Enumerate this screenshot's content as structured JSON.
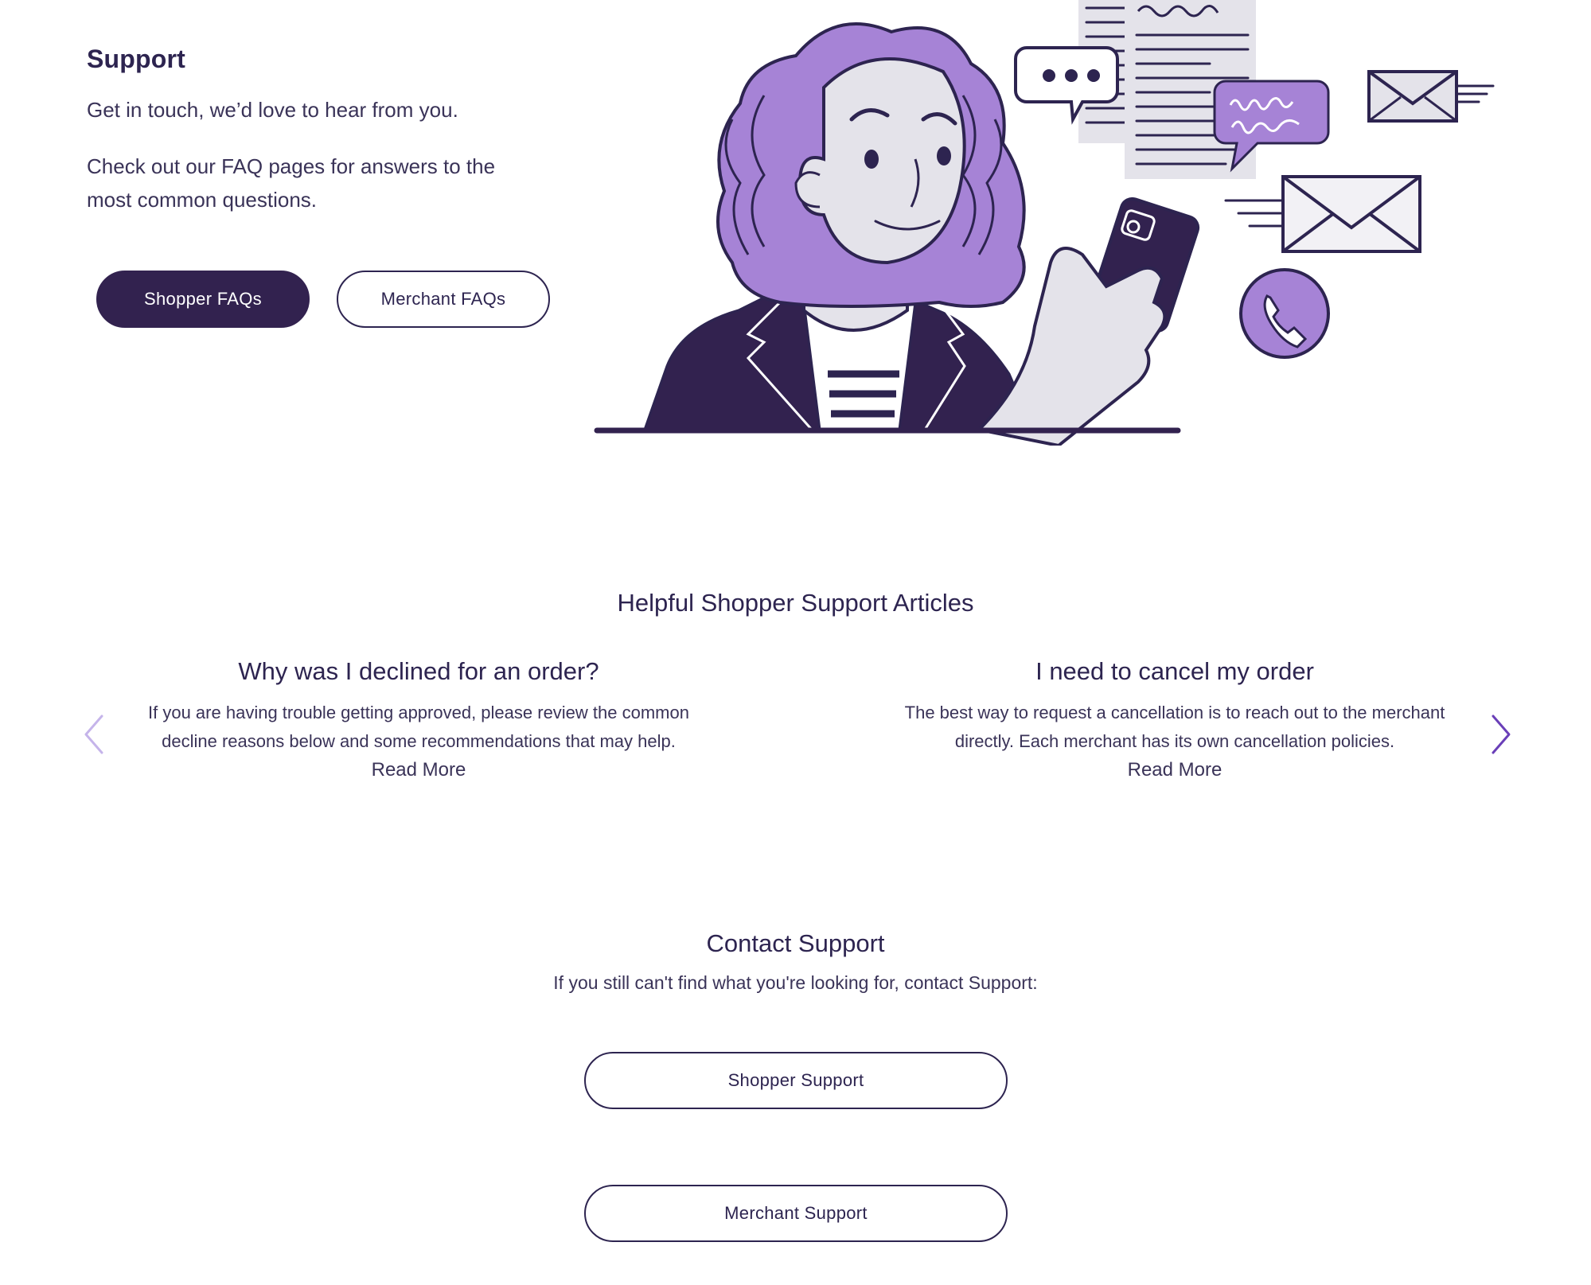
{
  "hero": {
    "title": "Support",
    "intro": "Get in touch, we’d love to hear from you.",
    "faq_text": "Check out our FAQ pages for answers to the most common questions.",
    "shopper_faq_label": "Shopper FAQs",
    "merchant_faq_label": "Merchant FAQs"
  },
  "articles": {
    "heading": "Helpful Shopper Support Articles",
    "items": [
      {
        "title": "Why was I declined for an order?",
        "body": "If you are having trouble getting approved, please review the common decline reasons below and some recommendations that may help.",
        "link": "Read More"
      },
      {
        "title": "I need to cancel my order",
        "body": "The best way to request a cancellation is to reach out to the merchant directly. Each merchant has its own cancellation policies.",
        "link": "Read More"
      }
    ]
  },
  "contact": {
    "heading": "Contact Support",
    "subtitle": "If you still can't find what you're looking for, contact Support:",
    "shopper_support_label": "Shopper Support",
    "merchant_support_label": "Merchant Support"
  },
  "colors": {
    "primary": "#32224f",
    "accent": "#a683d6",
    "text": "#2d2450",
    "light_gray": "#e4e3ea"
  },
  "icons": {
    "prev": "chevron-left-icon",
    "next": "chevron-right-icon"
  }
}
